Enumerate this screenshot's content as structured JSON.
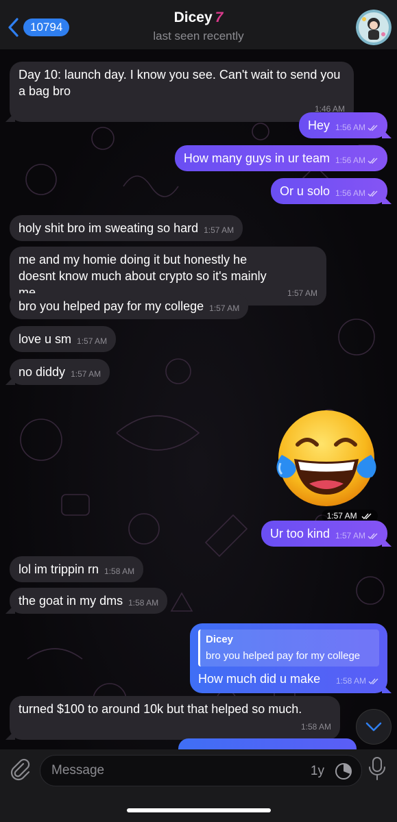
{
  "header": {
    "back_count": "10794",
    "contact_name": "Dicey",
    "name_emoji": "7",
    "status": "last seen recently"
  },
  "messages": [
    {
      "dir": "in",
      "text": "Day 10: launch day. I know you see. Can't wait to send you a bag bro",
      "time": "1:46 AM"
    },
    {
      "dir": "out",
      "text": "Hey",
      "time": "1:56 AM"
    },
    {
      "dir": "out",
      "text": "How many guys in ur team",
      "time": "1:56 AM"
    },
    {
      "dir": "out",
      "text": "Or u solo",
      "time": "1:56 AM"
    },
    {
      "dir": "in",
      "text": "holy shit bro im sweating so hard",
      "time": "1:57 AM"
    },
    {
      "dir": "in",
      "text": "me and my homie doing it but honestly he doesnt know much about crypto so it's mainly me",
      "time": "1:57 AM"
    },
    {
      "dir": "in",
      "text": "bro you helped pay for my college",
      "time": "1:57 AM"
    },
    {
      "dir": "in",
      "text": "love u sm",
      "time": "1:57 AM"
    },
    {
      "dir": "in",
      "text": "no diddy",
      "time": "1:57 AM"
    },
    {
      "dir": "out",
      "type": "sticker",
      "emoji": "😂",
      "time": "1:57 AM"
    },
    {
      "dir": "out",
      "text": "Ur too kind",
      "time": "1:57 AM"
    },
    {
      "dir": "in",
      "text": "lol im trippin rn",
      "time": "1:58 AM"
    },
    {
      "dir": "in",
      "text": "the goat in my dms",
      "time": "1:58 AM"
    },
    {
      "dir": "out",
      "type": "reply",
      "reply_name": "Dicey",
      "reply_text": "bro you helped pay for my college",
      "text": "How much did u make",
      "time": "1:58 AM"
    },
    {
      "dir": "in",
      "text": "turned $100 to around 10k but that helped so much.",
      "time": "1:58 AM"
    }
  ],
  "input": {
    "placeholder": "Message",
    "timer_label": "1y"
  },
  "colors": {
    "accent": "#2f7ff0",
    "outgoing": "#7552f4",
    "incoming": "#29272d"
  },
  "icons": [
    "chevron-left-icon",
    "paperclip-icon",
    "timer-icon",
    "microphone-icon",
    "chevron-down-icon",
    "double-check-icon"
  ]
}
